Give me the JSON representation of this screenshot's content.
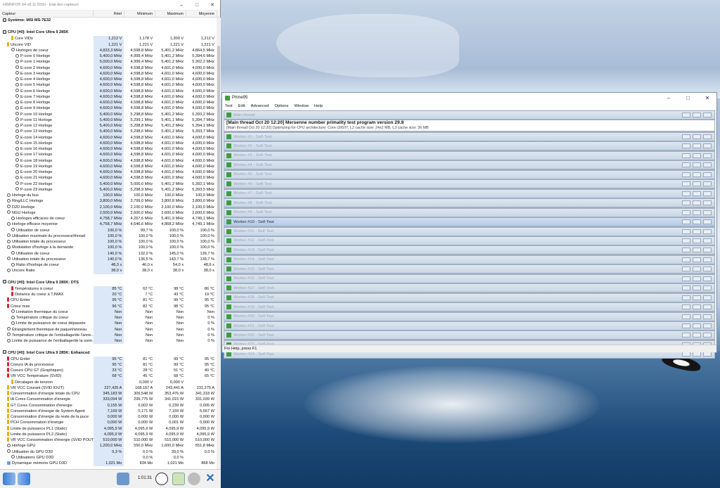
{
  "hwinfo": {
    "title": "HWiNFO® 64 v8.11-5550 - État des capteurs",
    "columns": [
      "Capteur",
      "Réel",
      "Minimum",
      "Maximum",
      "Moyenne"
    ],
    "elapsed": "1:01:31",
    "rows": [
      {
        "t": "sec",
        "n": "Système: MSI MS-7E32",
        "ind": 0
      },
      {
        "t": "sp",
        "n": "",
        "ind": 0
      },
      {
        "t": "sec",
        "n": "CPU [#0]: Intel Core Ultra 9 285K",
        "ind": 0
      },
      {
        "n": "Core VIDs",
        "r": "1,212 V",
        "mi": "1,178 V",
        "ma": "1,309 V",
        "mo": "1,212 V",
        "ind": 2,
        "ic": "v"
      },
      {
        "n": "Uncore VID",
        "r": "1,221 V",
        "mi": "1,221 V",
        "ma": "1,221 V",
        "mo": "1,221 V",
        "ind": 1,
        "ic": "v"
      },
      {
        "n": "Horloges de coeur",
        "r": "4,833,3 MHz",
        "mi": "4,598,8 MHz",
        "ma": "5,401,2 MHz",
        "mo": "4,864,5 MHz",
        "ind": 2,
        "ic": "c"
      },
      {
        "n": "P-core 0 Horloge",
        "r": "5,400,0 MHz",
        "mi": "4,999,4 MHz",
        "ma": "5,401,2 MHz",
        "mo": "5,394,6 MHz",
        "ind": 3,
        "ic": "c"
      },
      {
        "n": "P-core 1 Horloge",
        "r": "5,000,0 MHz",
        "mi": "4,999,4 MHz",
        "ma": "5,401,2 MHz",
        "mo": "5,302,2 MHz",
        "ind": 3,
        "ic": "c"
      },
      {
        "n": "E-core 2 Horloge",
        "r": "4,600,0 MHz",
        "mi": "4,598,8 MHz",
        "ma": "4,601,0 MHz",
        "mo": "4,600,0 MHz",
        "ind": 3,
        "ic": "c"
      },
      {
        "n": "E-core 3 Horloge",
        "r": "4,600,0 MHz",
        "mi": "4,598,8 MHz",
        "ma": "4,601,0 MHz",
        "mo": "4,600,0 MHz",
        "ind": 3,
        "ic": "c"
      },
      {
        "n": "E-core 4 Horloge",
        "r": "4,600,0 MHz",
        "mi": "4,598,8 MHz",
        "ma": "4,601,0 MHz",
        "mo": "4,600,0 MHz",
        "ind": 3,
        "ic": "c"
      },
      {
        "n": "E-core 5 Horloge",
        "r": "4,600,0 MHz",
        "mi": "4,598,8 MHz",
        "ma": "4,601,0 MHz",
        "mo": "4,600,0 MHz",
        "ind": 3,
        "ic": "c"
      },
      {
        "n": "E-core 6 Horloge",
        "r": "4,600,0 MHz",
        "mi": "4,598,8 MHz",
        "ma": "4,601,0 MHz",
        "mo": "4,600,0 MHz",
        "ind": 3,
        "ic": "c"
      },
      {
        "n": "E-core 7 Horloge",
        "r": "4,600,0 MHz",
        "mi": "4,598,8 MHz",
        "ma": "4,601,0 MHz",
        "mo": "4,600,0 MHz",
        "ind": 3,
        "ic": "c"
      },
      {
        "n": "E-core 8 Horloge",
        "r": "4,600,0 MHz",
        "mi": "4,598,8 MHz",
        "ma": "4,601,0 MHz",
        "mo": "4,600,0 MHz",
        "ind": 3,
        "ic": "c"
      },
      {
        "n": "E-core 9 Horloge",
        "r": "4,600,0 MHz",
        "mi": "4,598,8 MHz",
        "ma": "4,601,0 MHz",
        "mo": "4,600,0 MHz",
        "ind": 3,
        "ic": "c"
      },
      {
        "n": "P-core 10 Horloge",
        "r": "5,400,0 MHz",
        "mi": "5,298,8 MHz",
        "ma": "5,401,2 MHz",
        "mo": "5,393,2 MHz",
        "ind": 3,
        "ic": "c"
      },
      {
        "n": "P-core 11 Horloge",
        "r": "5,400,0 MHz",
        "mi": "5,299,1 MHz",
        "ma": "5,401,1 MHz",
        "mo": "5,394,7 MHz",
        "ind": 3,
        "ic": "c"
      },
      {
        "n": "P-core 12 Horloge",
        "r": "5,400,0 MHz",
        "mi": "5,298,8 MHz",
        "ma": "5,401,2 MHz",
        "mo": "5,394,1 MHz",
        "ind": 3,
        "ic": "c"
      },
      {
        "n": "P-core 13 Horloge",
        "r": "5,400,0 MHz",
        "mi": "5,298,6 MHz",
        "ma": "5,401,2 MHz",
        "mo": "5,393,7 MHz",
        "ind": 3,
        "ic": "c"
      },
      {
        "n": "E-core 14 Horloge",
        "r": "4,600,0 MHz",
        "mi": "4,598,8 MHz",
        "ma": "4,601,0 MHz",
        "mo": "4,600,0 MHz",
        "ind": 3,
        "ic": "c"
      },
      {
        "n": "E-core 15 Horloge",
        "r": "4,600,0 MHz",
        "mi": "4,598,8 MHz",
        "ma": "4,601,0 MHz",
        "mo": "4,600,0 MHz",
        "ind": 3,
        "ic": "c"
      },
      {
        "n": "E-core 16 Horloge",
        "r": "4,600,0 MHz",
        "mi": "4,598,8 MHz",
        "ma": "4,601,0 MHz",
        "mo": "4,600,0 MHz",
        "ind": 3,
        "ic": "c"
      },
      {
        "n": "E-core 17 Horloge",
        "r": "4,600,0 MHz",
        "mi": "4,598,8 MHz",
        "ma": "4,601,0 MHz",
        "mo": "4,600,0 MHz",
        "ind": 3,
        "ic": "c"
      },
      {
        "n": "E-core 18 Horloge",
        "r": "4,600,0 MHz",
        "mi": "4,598,8 MHz",
        "ma": "4,601,0 MHz",
        "mo": "4,600,0 MHz",
        "ind": 3,
        "ic": "c"
      },
      {
        "n": "E-core 19 Horloge",
        "r": "4,600,0 MHz",
        "mi": "4,598,8 MHz",
        "ma": "4,601,0 MHz",
        "mo": "4,600,0 MHz",
        "ind": 3,
        "ic": "c"
      },
      {
        "n": "E-core 20 Horloge",
        "r": "4,600,0 MHz",
        "mi": "4,598,8 MHz",
        "ma": "4,601,0 MHz",
        "mo": "4,600,0 MHz",
        "ind": 3,
        "ic": "c"
      },
      {
        "n": "E-core 21 Horloge",
        "r": "4,600,0 MHz",
        "mi": "4,598,8 MHz",
        "ma": "4,601,0 MHz",
        "mo": "4,600,0 MHz",
        "ind": 3,
        "ic": "c"
      },
      {
        "n": "P-core 22 Horloge",
        "r": "5,400,0 MHz",
        "mi": "5,000,0 MHz",
        "ma": "5,401,2 MHz",
        "mo": "5,392,1 MHz",
        "ind": 3,
        "ic": "c"
      },
      {
        "n": "P-core 23 Horloge",
        "r": "5,400,0 MHz",
        "mi": "5,298,9 MHz",
        "ma": "5,401,2 MHz",
        "mo": "5,393,5 MHz",
        "ind": 3,
        "ic": "c"
      },
      {
        "n": "Horloge du bus",
        "r": "100,0 MHz",
        "mi": "100,0 MHz",
        "ma": "100,0 MHz",
        "mo": "100,0 MHz",
        "ind": 1,
        "ic": "c"
      },
      {
        "n": "Ring/LLC Horloge",
        "r": "3,800,0 MHz",
        "mi": "3,799,0 MHz",
        "ma": "3,800,8 MHz",
        "mo": "3,800,0 MHz",
        "ind": 1,
        "ic": "c"
      },
      {
        "n": "D2D Horloge",
        "r": "2,100,0 MHz",
        "mi": "2,100,0 MHz",
        "ma": "2,100,0 MHz",
        "mo": "2,100,0 MHz",
        "ind": 1,
        "ic": "c"
      },
      {
        "n": "NGU Horloge",
        "r": "2,600,0 MHz",
        "mi": "2,600,0 MHz",
        "ma": "2,600,0 MHz",
        "mo": "2,600,0 MHz",
        "ind": 1,
        "ic": "c"
      },
      {
        "n": "Horloges efficaces de coeur",
        "r": "4,758,7 MHz",
        "mi": "4,267,6 MHz",
        "ma": "5,401,9 MHz",
        "mo": "4,749,1 MHz",
        "ind": 2,
        "ic": "c"
      },
      {
        "n": "Horloge efficace moyenne",
        "r": "4,758,7 MHz",
        "mi": "4,646,6 MHz",
        "ma": "4,868,2 MHz",
        "mo": "4,749,1 MHz",
        "ind": 1,
        "ic": "c"
      },
      {
        "n": "Utilisation de coeur",
        "r": "100,0 %",
        "mi": "99,7 %",
        "ma": "100,0 %",
        "mo": "100,0 %",
        "ind": 2,
        "ic": "c"
      },
      {
        "n": "Utilisation maximale du processeur/thread",
        "r": "100,0 %",
        "mi": "100,0 %",
        "ma": "100,0 %",
        "mo": "100,0 %",
        "ind": 1,
        "ic": "c"
      },
      {
        "n": "Utilisation totale du processeur",
        "r": "100,0 %",
        "mi": "100,0 %",
        "ma": "100,0 %",
        "mo": "100,0 %",
        "ind": 1,
        "ic": "c"
      },
      {
        "n": "Modulation d'horloge à la demande",
        "r": "100,0 %",
        "mi": "100,0 %",
        "ma": "100,0 %",
        "mo": "100,0 %",
        "ind": 1,
        "ic": "c"
      },
      {
        "n": "Utilisation de coeur",
        "r": "140,0 %",
        "mi": "132,0 %",
        "ma": "145,0 %",
        "mo": "139,7 %",
        "ind": 2,
        "ic": "c"
      },
      {
        "n": "Utilisation totale du processeur",
        "r": "140,0 %",
        "mi": "136,5 %",
        "ma": "143,7 %",
        "mo": "139,7 %",
        "ind": 1,
        "ic": "c"
      },
      {
        "n": "Ratio d'horloge de coeur",
        "r": "48,3 x",
        "mi": "46,0 x",
        "ma": "54,0 x",
        "mo": "48,6 x",
        "ind": 2,
        "ic": "c"
      },
      {
        "n": "Uncore Ratio",
        "r": "38,0 x",
        "mi": "38,0 x",
        "ma": "38,0 x",
        "mo": "38,0 x",
        "ind": 1,
        "ic": "c"
      },
      {
        "t": "sp",
        "n": "",
        "ind": 0
      },
      {
        "t": "sec",
        "n": "CPU [#0]: Intel Core Ultra 9 285K: DTS",
        "ind": 0
      },
      {
        "n": "Températures à coeur",
        "r": "85 °C",
        "mi": "62 °C",
        "ma": "98 °C",
        "mo": "86 °C",
        "ind": 2,
        "ic": "t"
      },
      {
        "n": "Distance du coeur à TJMAX",
        "r": "20 °C",
        "mi": "7 °C",
        "ma": "43 °C",
        "mo": "19 °C",
        "ind": 2,
        "ic": "t"
      },
      {
        "n": "CPU Entier",
        "r": "95 °C",
        "mi": "81 °C",
        "ma": "99 °C",
        "mo": "95 °C",
        "ind": 1,
        "ic": "t"
      },
      {
        "n": "Coeur max",
        "r": "96 °C",
        "mi": "82 °C",
        "ma": "98 °C",
        "mo": "95 °C",
        "ind": 1,
        "ic": "t"
      },
      {
        "n": "Limitation thermique du coeur",
        "r": "Non",
        "mi": "Non",
        "ma": "Non",
        "mo": "Non",
        "ind": 2,
        "ic": "c"
      },
      {
        "n": "Température critique du coeur",
        "r": "Non",
        "mi": "Non",
        "ma": "Non",
        "mo": "0 %",
        "ind": 2,
        "ic": "c"
      },
      {
        "n": "Limite de puissance de coeur dépassée",
        "r": "Non",
        "mi": "Non",
        "ma": "Non",
        "mo": "0 %",
        "ind": 2,
        "ic": "c"
      },
      {
        "n": "Étranglement thermique de paquet/anneau",
        "r": "Non",
        "mi": "Non",
        "ma": "Non",
        "mo": "0 %",
        "ind": 1,
        "ic": "c"
      },
      {
        "n": "Température critique de l'emballage/de l'anne...",
        "r": "Non",
        "mi": "Non",
        "ma": "Non",
        "mo": "0 %",
        "ind": 1,
        "ic": "c"
      },
      {
        "n": "Limite de puissance de l'emballage/de la sonn...",
        "r": "Non",
        "mi": "Non",
        "ma": "Non",
        "mo": "0 %",
        "ind": 1,
        "ic": "c"
      },
      {
        "t": "sp",
        "n": "",
        "ind": 0
      },
      {
        "t": "sec",
        "n": "CPU [#0]: Intel Core Ultra 9 285K: Enhanced",
        "ind": 0
      },
      {
        "n": "CPU Entier",
        "r": "95 °C",
        "mi": "81 °C",
        "ma": "99 °C",
        "mo": "95 °C",
        "ind": 1,
        "ic": "t"
      },
      {
        "n": "Coeurs IA du processeur",
        "r": "95 °C",
        "mi": "81 °C",
        "ma": "99 °C",
        "mo": "95 °C",
        "ind": 1,
        "ic": "t"
      },
      {
        "n": "Coeurs CPU GT (Graphiques)",
        "r": "33 °C",
        "mi": "28 °C",
        "ma": "51 °C",
        "mo": "40 °C",
        "ind": 1,
        "ic": "t"
      },
      {
        "n": "VR VCC Température (SVID)",
        "r": "68 °C",
        "mi": "45 °C",
        "ma": "68 °C",
        "mo": "65 °C",
        "ind": 1,
        "ic": "t"
      },
      {
        "n": "Décalages de tension",
        "r": "",
        "mi": "0,000 V",
        "ma": "0,000 V",
        "mo": "",
        "ind": 2,
        "ic": "v"
      },
      {
        "n": "VR VCC Courant (SVID IOUT)",
        "r": "227,425 A",
        "mi": "168,167 A",
        "ma": "243,441 A",
        "mo": "231,275 A",
        "ind": 1,
        "ic": "w"
      },
      {
        "n": "Consommation d'énergie totale du CPU",
        "r": "345,183 W",
        "mi": "309,548 W",
        "ma": "353,476 W",
        "mo": "341,318 W",
        "ind": 1,
        "ic": "w"
      },
      {
        "n": "IA Cores Consommation d'énergie",
        "r": "333,094 W",
        "mi": "299,775 W",
        "ma": "341,015 W",
        "mo": "331,039 W",
        "ind": 1,
        "ic": "w"
      },
      {
        "n": "GT Cores Consommation d'énergie",
        "r": "0,155 W",
        "mi": "0,002 W",
        "ma": "0,239 W",
        "mo": "0,005 W",
        "ind": 1,
        "ic": "w"
      },
      {
        "n": "Consommation d'énergie de System Agent",
        "r": "7,169 W",
        "mi": "5,171 W",
        "ma": "7,169 W",
        "mo": "5,567 W",
        "ind": 1,
        "ic": "w"
      },
      {
        "n": "Consommation d'énergie du reste de la puce",
        "r": "0,000 W",
        "mi": "0,000 W",
        "ma": "0,000 W",
        "mo": "0,000 W",
        "ind": 1,
        "ic": "w"
      },
      {
        "n": "PCH Consommation d'énergie",
        "r": "0,000 W",
        "mi": "0,000 W",
        "ma": "0,001 W",
        "mo": "0,000 W",
        "ind": 1,
        "ic": "w"
      },
      {
        "n": "Limite de puissance PL1 (Static)",
        "r": "4,095,9 W",
        "mi": "4,095,9 W",
        "ma": "4,095,9 W",
        "mo": "4,095,9 W",
        "ind": 1,
        "ic": "w"
      },
      {
        "n": "Limite de puissance PL2 (Static)",
        "r": "4,095,9 W",
        "mi": "4,095,9 W",
        "ma": "4,095,9 W",
        "mo": "4,095,9 W",
        "ind": 1,
        "ic": "w"
      },
      {
        "n": "VR VCC Consommation d'énergie (SVID POUT)",
        "r": "510,000 W",
        "mi": "510,000 W",
        "ma": "510,000 W",
        "mo": "510,000 W",
        "ind": 1,
        "ic": "w"
      },
      {
        "n": "Horloge GPU",
        "r": "1,200,0 MHz",
        "mi": "550,0 MHz",
        "ma": "1,600,0 MHz",
        "mo": "551,8 MHz",
        "ind": 1,
        "ic": "c"
      },
      {
        "n": "Utilisation du GPU D3D",
        "r": "9,3 %",
        "mi": "0,0 %",
        "ma": "39,0 %",
        "mo": "0,0 %",
        "ind": 1,
        "ic": "c"
      },
      {
        "n": "Utilisations GPU D3D",
        "r": "",
        "mi": "0,0 %",
        "ma": "0,0 %",
        "mo": "",
        "ind": 2,
        "ic": "c"
      },
      {
        "n": "Dynamique mémoire GPU D3D",
        "r": "1,021 Mo",
        "mi": "834 Mo",
        "ma": "1,021 Mo",
        "mo": "868 Mo",
        "ind": 1,
        "ic": "p"
      }
    ]
  },
  "prime95": {
    "title": "Prime95",
    "menu": [
      "Test",
      "Edit",
      "Advanced",
      "Options",
      "Window",
      "Help"
    ],
    "main_thread_title": "Main thread",
    "main_thread_line1": "[Main thread Oct 20 12:20] Mersenne number primality test program version 29.8",
    "main_thread_line2": "[Main thread Oct 20 12:20] Optimizing for CPU architecture: Core i3/i5/i7, L2 cache size: 24x2 MB, L3 cache size: 36 MB",
    "active_worker": "Worker #10 - Self-Test",
    "workers": [
      "Worker #1 - Self-Test",
      "Worker #2 - Self-Test",
      "Worker #3 - Self-Test",
      "Worker #4 - Self-Test",
      "Worker #5 - Self-Test",
      "Worker #6 - Self-Test",
      "Worker #7 - Self-Test",
      "Worker #8 - Self-Test",
      "Worker #9 - Self-Test",
      "Worker #10 - Self-Test",
      "Worker #11 - Self-Test",
      "Worker #12 - Self-Test",
      "Worker #13 - Self-Test",
      "Worker #14 - Self-Test",
      "Worker #15 - Self-Test",
      "Worker #16 - Self-Test",
      "Worker #17 - Self-Test",
      "Worker #18 - Self-Test",
      "Worker #19 - Self-Test",
      "Worker #20 - Self-Test",
      "Worker #21 - Self-Test",
      "Worker #22 - Self-Test",
      "Worker #23 - Self-Test",
      "Worker #24 - Self-Test"
    ],
    "status": "For Help, press F1"
  }
}
